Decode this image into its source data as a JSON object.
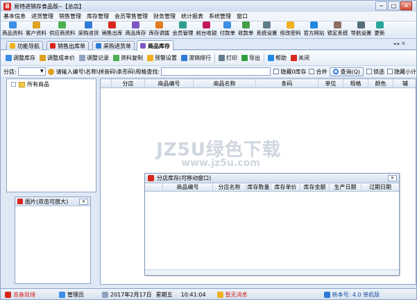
{
  "window": {
    "title": "易特进销存食品版--【总店】",
    "app_icon_text": "易"
  },
  "window_controls": [
    "─",
    "□",
    "✕"
  ],
  "menu": [
    "基本信息",
    "进货管理",
    "销售管理",
    "库存管理",
    "会员零售管理",
    "财务管理",
    "统计报表",
    "系统管理",
    "窗口"
  ],
  "toolbar": [
    {
      "label": "商品资料",
      "color": "#3a8ee6"
    },
    {
      "label": "客户资料",
      "color": "#e0a020"
    },
    {
      "label": "供应商资料",
      "color": "#4caf50"
    },
    {
      "label": "采购进货",
      "color": "#2e7bd6"
    },
    {
      "label": "销售出库",
      "color": "#d9261c"
    },
    {
      "label": "商品库存",
      "color": "#7e57c2"
    },
    {
      "label": "库存调拨",
      "color": "#e07b20"
    },
    {
      "label": "会员管理",
      "color": "#2e9e8f"
    },
    {
      "label": "前台收银",
      "color": "#c2185b"
    },
    {
      "label": "付款单",
      "color": "#3a8ee6"
    },
    {
      "label": "收款单",
      "color": "#43a047"
    },
    {
      "label": "系统设置",
      "color": "#607d8b"
    },
    {
      "label": "修改密码",
      "color": "#f2b01e"
    },
    {
      "label": "官方网站",
      "color": "#1e88e5"
    },
    {
      "label": "锁定系统",
      "color": "#8d6e63"
    },
    {
      "label": "导航设置",
      "color": "#546e7a"
    },
    {
      "label": "更新",
      "color": "#26a69a"
    }
  ],
  "tabs": [
    {
      "label": "功能导航",
      "color": "#f2b01e"
    },
    {
      "label": "销售出库单",
      "color": "#d9261c"
    },
    {
      "label": "采购进货单",
      "color": "#2e7bd6"
    },
    {
      "label": "商品库存",
      "color": "#7e57c2"
    }
  ],
  "tab_nav": "◂ ▸ ✕",
  "subtoolbar": [
    {
      "label": "调整库存",
      "color": "#3a8ee6"
    },
    {
      "label": "调整成本价",
      "color": "#e0a020"
    },
    {
      "label": "调整记录",
      "color": "#8fa3bf"
    },
    {
      "label": "资料复制",
      "color": "#4caf50"
    },
    {
      "label": "预警设置",
      "color": "#f2b01e"
    },
    {
      "label": "滞销排行",
      "color": "#2e7bd6"
    },
    {
      "label": "打印",
      "color": "#607d8b"
    },
    {
      "label": "导出",
      "color": "#2e9e3f"
    },
    {
      "label": "帮助",
      "color": "#1e88e5"
    },
    {
      "label": "关闭",
      "color": "#d9261c"
    }
  ],
  "filter": {
    "branch_label": "分店:",
    "branch_value": "",
    "search_label": "请输入编号\\名称\\拼音码\\条形码\\规格查找:",
    "search_value": "",
    "hide_zero_stock": "隐藏0库存",
    "merge": "合并",
    "query_button": "查询(Q)",
    "select_label": "锁选",
    "hide_subtotal": "隐藏小计"
  },
  "tree": {
    "root": "所有商品"
  },
  "image_panel": {
    "title": "图片(双击可放大)",
    "close": "✕"
  },
  "grid": {
    "columns": [
      "",
      "分店",
      "商品编号",
      "商品名称",
      "条码",
      "单位",
      "规格",
      "颜色",
      "辅"
    ]
  },
  "stock_window": {
    "title": "分店库存(可移动窗口)",
    "close": "✕",
    "columns": [
      "商品编号",
      "分店名称",
      "库存数量",
      "库存单价",
      "库存金额",
      "生产日期",
      "过期日期"
    ]
  },
  "watermark": {
    "line1": "JZ5U绿色下载",
    "line2": "www.jz5u.com"
  },
  "statusbar": {
    "status": "准备就绪",
    "user": "管理员",
    "date": "2017年2月17日",
    "weekday": "星期五",
    "time": "10:41:04",
    "message": "暂无消息",
    "version": "新本号: 4.0 单机版"
  }
}
